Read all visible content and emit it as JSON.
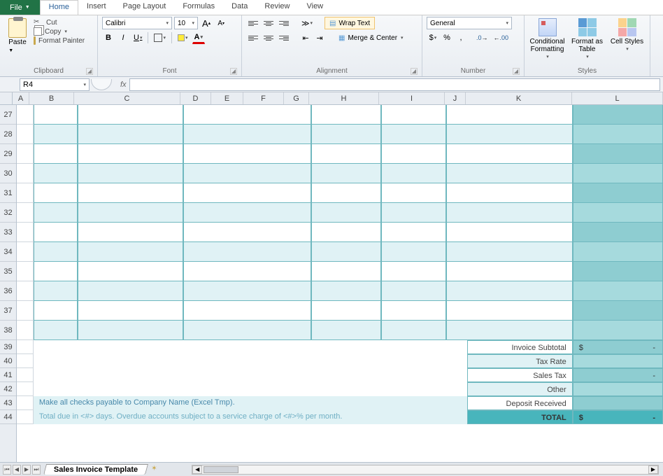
{
  "menu": {
    "file": "File",
    "items": [
      "Home",
      "Insert",
      "Page Layout",
      "Formulas",
      "Data",
      "Review",
      "View"
    ],
    "active": "Home"
  },
  "ribbon": {
    "clipboard": {
      "label": "Clipboard",
      "paste": "Paste",
      "cut": "Cut",
      "copy": "Copy",
      "format_painter": "Format Painter"
    },
    "font": {
      "label": "Font",
      "family": "Calibri",
      "size": "10",
      "bold": "B",
      "italic": "I",
      "underline": "U",
      "grow": "A",
      "shrink": "A"
    },
    "alignment": {
      "label": "Alignment",
      "wrap": "Wrap Text",
      "merge": "Merge & Center"
    },
    "number": {
      "label": "Number",
      "format": "General",
      "currency": "$",
      "percent": "%",
      "comma": ",",
      "inc": ".0",
      "dec": ".00"
    },
    "styles": {
      "label": "Styles",
      "cond": "Conditional Formatting",
      "table": "Format as Table",
      "cell": "Cell Styles"
    }
  },
  "formula_bar": {
    "name_box": "R4",
    "fx": "fx",
    "value": ""
  },
  "columns": [
    "A",
    "B",
    "C",
    "D",
    "E",
    "F",
    "G",
    "H",
    "I",
    "J",
    "K",
    "L"
  ],
  "rows": [
    27,
    28,
    29,
    30,
    31,
    32,
    33,
    34,
    35,
    36,
    37,
    38,
    39,
    40,
    41,
    42,
    43,
    44
  ],
  "summary": {
    "subtotal": "Invoice Subtotal",
    "tax_rate": "Tax Rate",
    "sales_tax": "Sales Tax",
    "other": "Other",
    "deposit": "Deposit Received",
    "total": "TOTAL",
    "currency": "$",
    "dash": "-"
  },
  "notes": {
    "line1": "Make all checks payable to Company Name (Excel Tmp).",
    "line2": "Total due in <#> days. Overdue accounts subject to a service charge of <#>% per month."
  },
  "sheet_tab": "Sales Invoice Template"
}
